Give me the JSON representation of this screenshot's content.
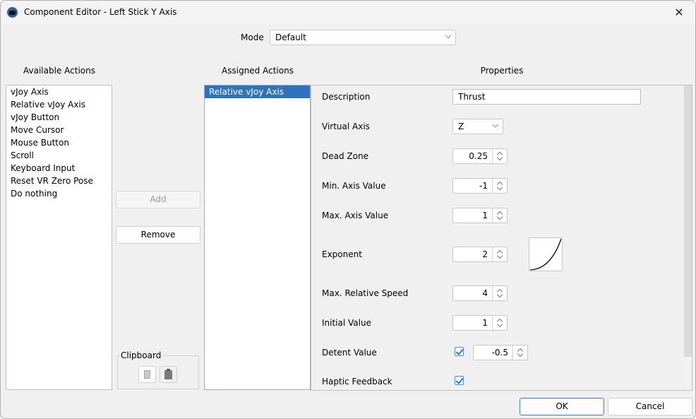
{
  "window": {
    "title": "Component Editor - Left Stick Y Axis",
    "app_icon": "joystick-icon",
    "close_icon": "close-icon",
    "close_glyph": "✕"
  },
  "mode": {
    "label": "Mode",
    "value": "Default"
  },
  "available_actions": {
    "title": "Available Actions",
    "items": [
      "vJoy Axis",
      "Relative vJoy Axis",
      "vJoy Button",
      "Move Cursor",
      "Mouse Button",
      "Scroll",
      "Keyboard Input",
      "Reset VR Zero Pose",
      "Do nothing"
    ]
  },
  "buttons": {
    "add": "Add",
    "remove": "Remove",
    "ok": "OK",
    "cancel": "Cancel"
  },
  "clipboard": {
    "title": "Clipboard",
    "copy_icon": "copy-icon",
    "paste_icon": "paste-icon"
  },
  "assigned_actions": {
    "title": "Assigned Actions",
    "items": [
      "Relative vJoy Axis"
    ],
    "selected_index": 0
  },
  "properties": {
    "title": "Properties",
    "description": {
      "label": "Description",
      "value": "Thrust"
    },
    "virtual_axis": {
      "label": "Virtual Axis",
      "value": "Z"
    },
    "dead_zone": {
      "label": "Dead Zone",
      "value": "0.25"
    },
    "min_axis_value": {
      "label": "Min. Axis Value",
      "value": "-1"
    },
    "max_axis_value": {
      "label": "Max. Axis Value",
      "value": "1"
    },
    "exponent": {
      "label": "Exponent",
      "value": "2"
    },
    "max_relative_speed": {
      "label": "Max. Relative Speed",
      "value": "4"
    },
    "initial_value": {
      "label": "Initial Value",
      "value": "1"
    },
    "detent_value": {
      "label": "Detent Value",
      "enabled": true,
      "value": "-0.5"
    },
    "haptic_feedback": {
      "label": "Haptic Feedback",
      "checked": true
    }
  },
  "colors": {
    "selection": "#2e72bd",
    "checkbox_border": "#4a90d9",
    "ok_border": "#3b7fd0"
  }
}
